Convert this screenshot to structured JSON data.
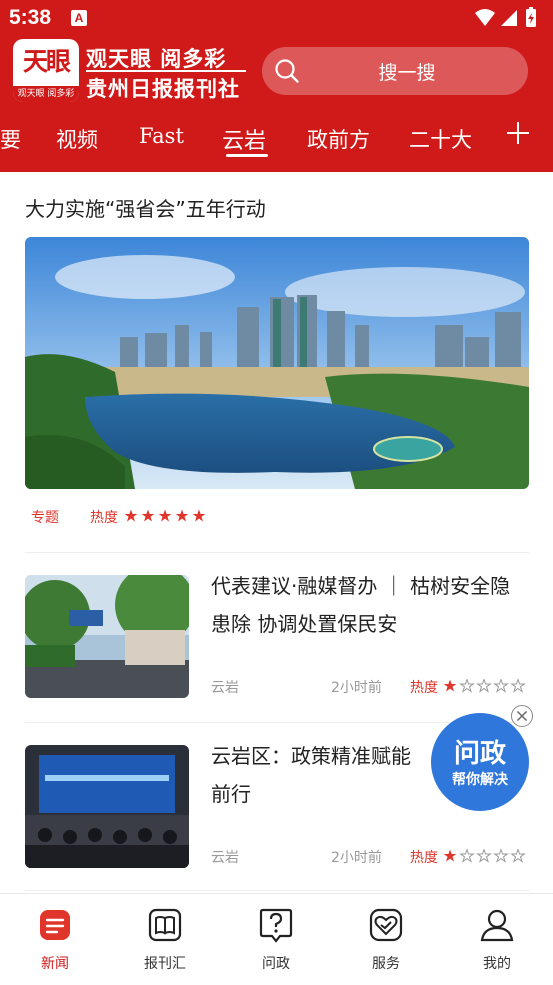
{
  "status_bar": {
    "time": "5:38",
    "notification_badge": "A"
  },
  "header": {
    "logo_mark": "天眼",
    "logo_sub": "观天眼 阅多彩",
    "brand_line1": "观天眼 阅多彩",
    "brand_line2": "贵州日报报刊社",
    "search_placeholder": "搜一搜",
    "background_color": "#d01a1a"
  },
  "tabs": [
    {
      "label": "要"
    },
    {
      "label": "视频"
    },
    {
      "label": "Fast"
    },
    {
      "label": "云岩",
      "active": true
    },
    {
      "label": "政前方"
    },
    {
      "label": "二十大"
    }
  ],
  "feature": {
    "title": "大力实施“强省会”五年行动",
    "tag": "专题",
    "heat_label": "热度",
    "heat_rating": 5
  },
  "news": [
    {
      "title": "代表建议·融媒督办 ｜ 枯树安全隐患除 协调处置保民安",
      "source": "云岩",
      "time": "2小时前",
      "heat_label": "热度",
      "heat_rating": 1
    },
    {
      "title": "云岩区：政策精准赋能 前行",
      "source": "云岩",
      "time": "2小时前",
      "heat_label": "热度",
      "heat_rating": 1
    }
  ],
  "float_button": {
    "line1": "问政",
    "line2": "帮你解决",
    "color": "#2f77db"
  },
  "bottom_nav": [
    {
      "label": "新闻",
      "icon": "news-icon",
      "active": true
    },
    {
      "label": "报刊汇",
      "icon": "book-icon"
    },
    {
      "label": "问政",
      "icon": "question-icon"
    },
    {
      "label": "服务",
      "icon": "heart-service-icon"
    },
    {
      "label": "我的",
      "icon": "user-icon"
    }
  ],
  "colors": {
    "accent": "#d01a1a",
    "heat": "#e0352b",
    "float": "#2f77db"
  }
}
